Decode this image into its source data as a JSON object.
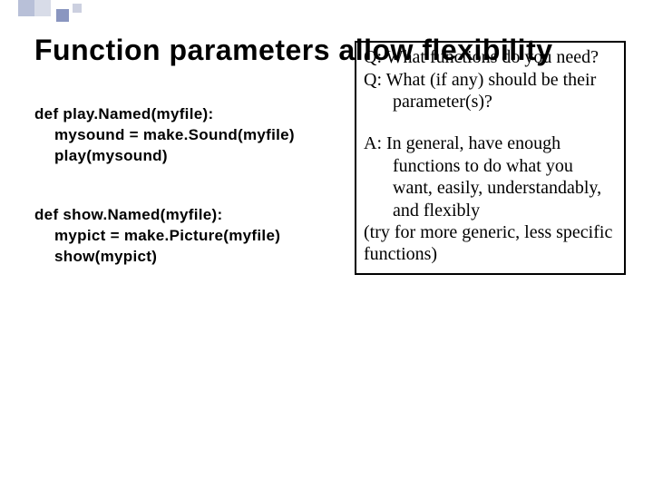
{
  "title": "Function parameters allow flexibility",
  "code1": {
    "l1": "def play.Named(myfile):",
    "l2": "mysound = make.Sound(myfile)",
    "l3": "play(mysound)"
  },
  "code2": {
    "l1": "def show.Named(myfile):",
    "l2": "mypict = make.Picture(myfile)",
    "l3": "show(mypict)"
  },
  "qa": {
    "q1": "Q: What functions do you need?",
    "q2": "Q: What (if any) should be their parameter(s)?",
    "a1": "A: In general, have enough functions to do what you want, easily, understandably, and flexibly",
    "a2": "(try for more generic, less specific functions)"
  }
}
